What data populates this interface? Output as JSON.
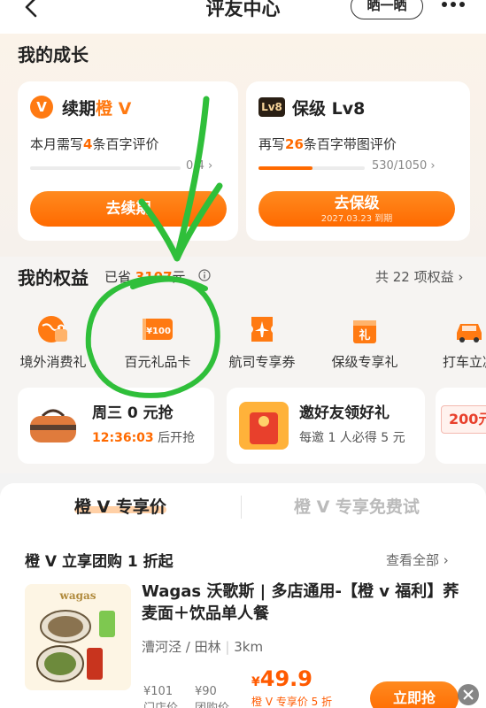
{
  "header": {
    "title": "评友中心",
    "share_label": "晒一晒"
  },
  "growth": {
    "section_title": "我的成长",
    "renew_card": {
      "badge": "V",
      "title_prefix": "续期",
      "title_highlight": "橙 V",
      "desc_prefix": "本月需写",
      "desc_count": "4",
      "desc_suffix": "条百字评价",
      "progress_text": "0/4 ›",
      "progress_fraction": 0.0,
      "button_label": "去续期"
    },
    "level_card": {
      "badge": "Lv8",
      "title": "保级 Lv8",
      "desc_prefix": "再写",
      "desc_count": "26",
      "desc_suffix": "条百字带图评价",
      "progress_text": "530/1050 ›",
      "progress_fraction": 0.505,
      "button_label": "去保级",
      "button_sub": "2027.03.23 到期"
    }
  },
  "benefits": {
    "section_title": "我的权益",
    "saved_prefix": "已省",
    "saved_amount": "3107",
    "saved_suffix": "元",
    "total_link": "共 22 项权益 ›",
    "items": [
      {
        "label": "境外消费礼",
        "icon": "globe-bag-icon"
      },
      {
        "label": "百元礼品卡",
        "icon": "gift-card-100-icon"
      },
      {
        "label": "航司专享券",
        "icon": "airplane-ticket-icon"
      },
      {
        "label": "保级专享礼",
        "icon": "gift-box-icon"
      },
      {
        "label": "打车立减",
        "icon": "car-icon"
      }
    ],
    "promos": [
      {
        "title": "周三 0 元抢",
        "timer": "12:36:03",
        "sub_suffix": "后开抢",
        "icon": "travel-bag-icon"
      },
      {
        "title": "邀好友领好礼",
        "sub": "每邀 1 人必得 5 元",
        "icon": "red-envelope-icon"
      },
      {
        "partial_text": "200元"
      }
    ]
  },
  "deals": {
    "tabs": [
      {
        "label": "橙 V 专享价",
        "active": true
      },
      {
        "label": "橙 V 专享免费试",
        "active": false
      }
    ],
    "group_title": "橙 V 立享团购 1 折起",
    "view_all": "查看全部 ›",
    "product": {
      "brand_mark": "wagas",
      "name": "Wagas 沃歌斯 | 多店通用-【橙 v 福利】荞麦面＋饮品单人餐",
      "location": "漕河泾 / 田林",
      "distance": "3km",
      "original_price": "¥101",
      "original_label": "门店价",
      "group_price": "¥90",
      "group_label": "团购价",
      "final_price_symbol": "¥",
      "final_price": "49.9",
      "price_note": "橙 V 专享价 5 折",
      "button_label": "立即抢"
    }
  }
}
